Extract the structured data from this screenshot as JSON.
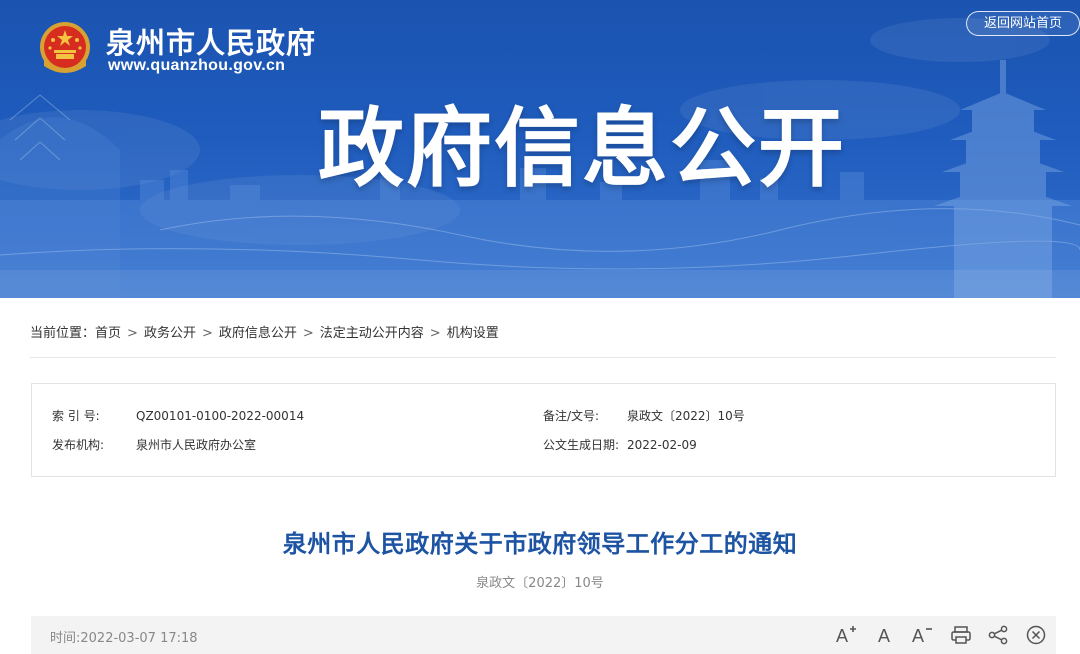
{
  "header": {
    "site_name": "泉州市人民政府",
    "site_url": "www.quanzhou.gov.cn",
    "return_label": "返回网站首页",
    "banner_title": "政府信息公开"
  },
  "breadcrumb": {
    "prefix": "当前位置：",
    "separator": ">",
    "items": [
      "首页",
      "政务公开",
      "政府信息公开",
      "法定主动公开内容",
      "机构设置"
    ]
  },
  "info": {
    "index_label": "索 引 号:",
    "index_value": "QZ00101-0100-2022-00014",
    "docno_label": "备注/文号:",
    "docno_value": "泉政文〔2022〕10号",
    "publisher_label": "发布机构:",
    "publisher_value": "泉州市人民政府办公室",
    "date_label": "公文生成日期:",
    "date_value": "2022-02-09"
  },
  "article": {
    "title": "泉州市人民政府关于市政府领导工作分工的通知",
    "doc_number": "泉政文〔2022〕10号",
    "time_label": "时间:",
    "time_value": "2022-03-07 17:18"
  },
  "toolbar": {
    "icons": [
      "font-increase-icon",
      "font-reset-icon",
      "font-decrease-icon",
      "print-icon",
      "share-icon",
      "close-icon"
    ]
  },
  "colors": {
    "banner_blue": "#1f5cbd",
    "title_blue": "#1c53a2",
    "toolbar_bg": "#f3f3f3"
  }
}
